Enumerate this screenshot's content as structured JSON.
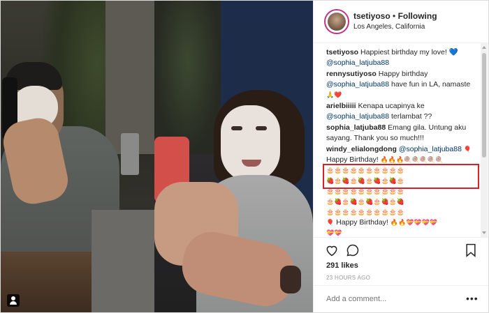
{
  "post": {
    "username": "tsetiyoso",
    "separator": " • ",
    "follow_label": "Following",
    "location": "Los Angeles, California"
  },
  "comments": [
    {
      "user": "tsetiyoso",
      "text": "Happiest birthday my love!",
      "emoji": "💙",
      "mention": "@sophia_latjuba88"
    },
    {
      "user": "rennysutiyoso",
      "text": "Happy birthday",
      "mention": "@sophia_latjuba88",
      "text2": "have fun in LA, namaste",
      "emoji": "🙏❤️"
    },
    {
      "user": "arielbiiiii",
      "text": "Kenapa ucapinya ke",
      "mention": "@sophia_latjuba88",
      "text2": "terlambat ??"
    },
    {
      "user": "sophia_latjuba88",
      "text": "Emang gila. Untung aku sayang. Thank you so much!!!"
    },
    {
      "user": "windy_elialongdong",
      "mention": "@sophia_latjuba88",
      "emoji": "🎈"
    },
    {
      "text": "Happy Birthday!",
      "emoji": "🔥🔥🔥🍭🍭🍭🍭🍭"
    },
    {
      "emoji": "🎂🎂🎂🎂🎂🎂🎂🎂🎂🎂"
    },
    {
      "emoji": "🍓🎂🍓🎂🍓🎂🍓🎂🍓🎂"
    },
    {
      "emoji": "🎂🎂🎂🎂🎂🎂🎂🎂🎂🎂"
    },
    {
      "emoji": "🎂🍓🎂🍓🎂🍓🎂🍓🎂🍓"
    },
    {
      "emoji": "🎂🎂🎂🎂🎂🎂🎂🎂🎂🎂"
    },
    {
      "text": "Happy Birthday!",
      "emoji_before": "🎈",
      "emoji": "🔥🔥💝💝💝💝"
    },
    {
      "emoji": "💝💝"
    },
    {
      "emoji": "🎂🎂🎂🎂🎂🎂🎂🎂"
    }
  ],
  "likes": "291 likes",
  "timestamp": "23 HOURS AGO",
  "add_comment_placeholder": "Add a comment...",
  "more_options": "•••",
  "icons": {
    "like": "heart-icon",
    "comment": "comment-icon",
    "save": "bookmark-icon",
    "tag": "user-tag-icon"
  },
  "colors": {
    "highlight": "#d92027",
    "mention": "#003569",
    "avatar_ring": "#c13584"
  }
}
